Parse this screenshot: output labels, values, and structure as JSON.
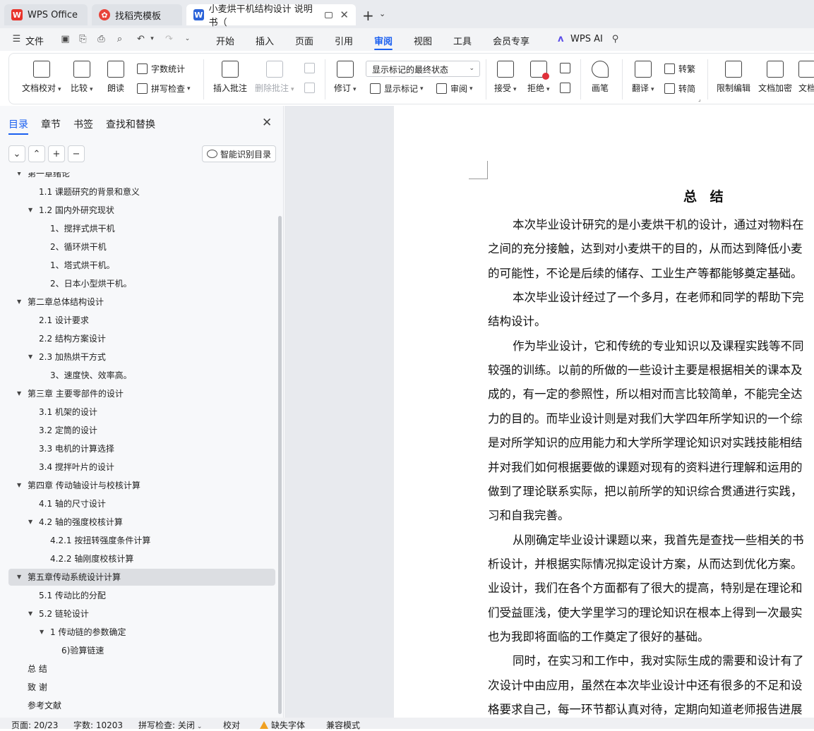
{
  "tabs": [
    {
      "label": "WPS Office",
      "icon": "wps-logo-icon",
      "active": false
    },
    {
      "label": "找稻壳模板",
      "icon": "docer-icon",
      "active": false
    },
    {
      "label": "小麦烘干机结构设计 说明书（",
      "icon": "word-doc-icon",
      "active": true
    }
  ],
  "menubar": {
    "file_label": "文件",
    "tabs": [
      "开始",
      "插入",
      "页面",
      "引用",
      "审阅",
      "视图",
      "工具",
      "会员专享"
    ],
    "active_tab": "审阅",
    "wps_ai_label": "WPS AI"
  },
  "ribbon": {
    "doc_proof": "文档校对",
    "compare": "比较",
    "read_aloud": "朗读",
    "word_count": "字数统计",
    "spell_check": "拼写检查",
    "insert_comment": "插入批注",
    "delete_comment": "删除批注",
    "track_changes": "修订",
    "markup_state": "显示标记的最终状态",
    "show_markup": "显示标记",
    "review": "审阅",
    "accept": "接受",
    "reject": "拒绝",
    "pen": "画笔",
    "translate": "翻译",
    "to_traditional": "转繁",
    "to_simplified": "转简",
    "restrict_edit": "限制编辑",
    "doc_encrypt": "文档加密",
    "doc_more": "文档"
  },
  "nav": {
    "tabs": [
      "目录",
      "章节",
      "书签",
      "查找和替换"
    ],
    "active_tab": "目录",
    "smart_toc": "智能识别目录",
    "toc": [
      {
        "label": "第一章绪论",
        "level": 1,
        "expanded": true
      },
      {
        "label": "1.1  课题研究的背景和意义",
        "level": 2
      },
      {
        "label": "1.2  国内外研究现状",
        "level": 2,
        "expanded": true
      },
      {
        "label": "1、搅拌式烘干机",
        "level": 3
      },
      {
        "label": "2、循环烘干机",
        "level": 3
      },
      {
        "label": "1、塔式烘干机。",
        "level": 3
      },
      {
        "label": "2、日本小型烘干机。",
        "level": 3
      },
      {
        "label": "第二章总体结构设计",
        "level": 1,
        "expanded": true
      },
      {
        "label": "2.1  设计要求",
        "level": 2
      },
      {
        "label": "2.2  结构方案设计",
        "level": 2
      },
      {
        "label": "2.3  加热烘干方式",
        "level": 2,
        "expanded": true
      },
      {
        "label": "3、速度快、效率高。",
        "level": 3
      },
      {
        "label": "第三章  主要零部件的设计",
        "level": 1,
        "expanded": true
      },
      {
        "label": "3.1  机架的设计",
        "level": 2
      },
      {
        "label": "3.2  定筒的设计",
        "level": 2
      },
      {
        "label": "3.3 电机的计算选择",
        "level": 2
      },
      {
        "label": "3.4  搅拌叶片的设计",
        "level": 2
      },
      {
        "label": "第四章  传动轴设计与校核计算",
        "level": 1,
        "expanded": true
      },
      {
        "label": "4.1  轴的尺寸设计",
        "level": 2
      },
      {
        "label": "4.2  轴的强度校核计算",
        "level": 2,
        "expanded": true
      },
      {
        "label": "4.2.1  按扭转强度条件计算",
        "level": 3
      },
      {
        "label": "4.2.2 轴刚度校核计算",
        "level": 3
      },
      {
        "label": "第五章传动系统设计计算",
        "level": 1,
        "expanded": true,
        "selected": true
      },
      {
        "label": "5.1  传动比的分配",
        "level": 2
      },
      {
        "label": "5.2  链轮设计",
        "level": 2,
        "expanded": true
      },
      {
        "label": "1 传动链的参数确定",
        "level": 3,
        "expanded": true
      },
      {
        "label": "6)验算链速",
        "level": 4
      },
      {
        "label": "总  结",
        "level": 1
      },
      {
        "label": "致  谢",
        "level": 1
      },
      {
        "label": "参考文献",
        "level": 1
      }
    ]
  },
  "document": {
    "title": "总 结",
    "lines": [
      {
        "text": "本次毕业设计研究的是小麦烘干机的设计，通过对物料在",
        "indent": true
      },
      {
        "text": "之间的充分接触，达到对小麦烘干的目的，从而达到降低小麦",
        "indent": false
      },
      {
        "text": "的可能性，不论是后续的储存、工业生产等都能够奠定基础。",
        "indent": false
      },
      {
        "text": "本次毕业设计经过了一个多月，在老师和同学的帮助下完",
        "indent": true
      },
      {
        "text": "结构设计。",
        "indent": false
      },
      {
        "text": "作为毕业设计，它和传统的专业知识以及课程实践等不同",
        "indent": true
      },
      {
        "text": "较强的训练。以前的所做的一些设计主要是根据相关的课本及",
        "indent": false
      },
      {
        "text": "成的，有一定的参照性，所以相对而言比较简单，不能完全达",
        "indent": false
      },
      {
        "text": "力的目的。而毕业设计则是对我们大学四年所学知识的一个综",
        "indent": false
      },
      {
        "text": "是对所学知识的应用能力和大学所学理论知识对实践技能相结",
        "indent": false
      },
      {
        "text": "并对我们如何根据要做的课题对现有的资料进行理解和运用的",
        "indent": false
      },
      {
        "text": "做到了理论联系实际，把以前所学的知识综合贯通进行实践，",
        "indent": false
      },
      {
        "text": "习和自我完善。",
        "indent": false
      },
      {
        "text": "从刚确定毕业设计课题以来，我首先是查找一些相关的书",
        "indent": true
      },
      {
        "text": "析设计，并根据实际情况拟定设计方案，从而达到优化方案。",
        "indent": false
      },
      {
        "text": "业设计，我们在各个方面都有了很大的提高，特别是在理论和",
        "indent": false
      },
      {
        "text": "们受益匪浅，使大学里学习的理论知识在根本上得到一次最实",
        "indent": false
      },
      {
        "text": "也为我即将面临的工作奠定了很好的基础。",
        "indent": false
      },
      {
        "text": "同时，在实习和工作中，我对实际生成的需要和设计有了",
        "indent": true
      },
      {
        "text": "次设计中由应用，虽然在本次毕业设计中还有很多的不足和设",
        "indent": false
      },
      {
        "text": "格要求自己，每一环节都认真对待，定期向知道老师报告进展",
        "indent": false
      }
    ]
  },
  "status": {
    "page": "页面: 20/23",
    "words": "字数: 10203",
    "spell": "拼写检查: 关闭",
    "proof": "校对",
    "missing_font": "缺失字体",
    "compat": "兼容模式"
  },
  "colors": {
    "accent": "#1a5ff0",
    "wps_red": "#e8332a",
    "word_blue": "#2b63d9"
  }
}
